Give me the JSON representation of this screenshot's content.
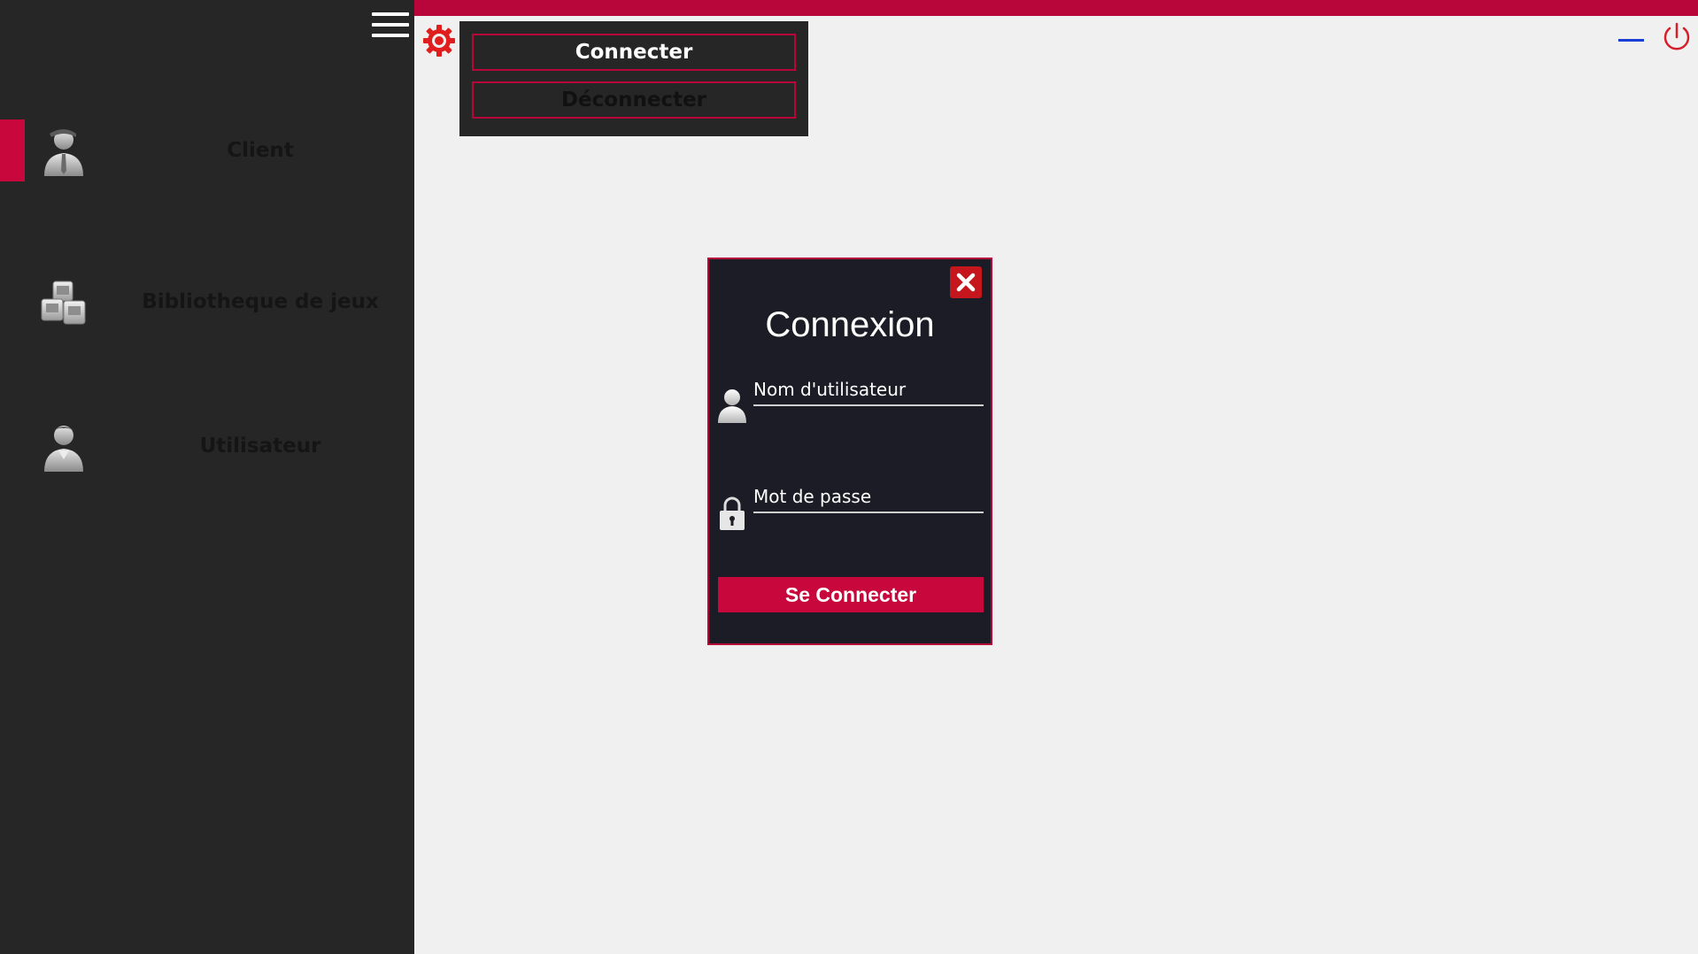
{
  "colors": {
    "accent": "#b8063b",
    "sidebar_bg": "#262626",
    "content_bg": "#f0f0f0",
    "dialog_bg": "#1c1c26",
    "close_red": "#c4161c",
    "minimize_blue": "#1a3fd6"
  },
  "sidebar": {
    "menu_icon": "hamburger-icon",
    "items": [
      {
        "label": "Client",
        "icon": "client-icon",
        "active": true
      },
      {
        "label": "Bibliotheque de jeux",
        "icon": "game-library-icon",
        "active": false
      },
      {
        "label": "Utilisateur",
        "icon": "user-icon",
        "active": false
      }
    ]
  },
  "settings_menu": {
    "icon": "gear-icon",
    "items": [
      {
        "label": "Connecter"
      },
      {
        "label": "Déconnecter"
      }
    ]
  },
  "window_controls": {
    "minimize_icon": "minimize-icon",
    "power_icon": "power-icon"
  },
  "login_dialog": {
    "title": "Connexion",
    "close_icon": "close-icon",
    "username": {
      "placeholder": "Nom d'utilisateur",
      "value": "",
      "icon": "person-icon"
    },
    "password": {
      "placeholder": "Mot de passe",
      "value": "",
      "icon": "lock-icon"
    },
    "submit_label": "Se Connecter"
  }
}
